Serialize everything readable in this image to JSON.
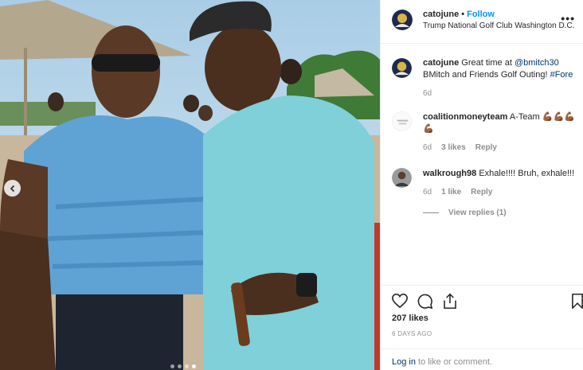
{
  "post": {
    "username": "catojune",
    "follow_label": "Follow",
    "location": "Trump National Golf Club Washington D.C.",
    "more_glyph": "•••"
  },
  "comments": [
    {
      "username": "catojune",
      "text_prefix": "Great time at ",
      "mention": "@bmitch30",
      "text_line2": "BMitch and Friends Golf Outing! ",
      "hashtag": "#Fore",
      "time": "6d"
    },
    {
      "username": "coalitionmoneyteam",
      "text": "A-Team 💪🏾💪🏾💪🏾💪🏾",
      "time": "6d",
      "likes": "3 likes",
      "reply_label": "Reply"
    },
    {
      "username": "walkrough98",
      "text": "Exhale!!!! Bruh, exhale!!!",
      "time": "6d",
      "likes": "1 like",
      "reply_label": "Reply",
      "view_replies": "View replies (1)"
    }
  ],
  "footer": {
    "likes": "207 likes",
    "date": "6 DAYS AGO",
    "login_link": "Log in",
    "login_rest": " to like or comment."
  },
  "carousel": {
    "slides": 4,
    "active_index": 3
  },
  "colors": {
    "link": "#0095f6",
    "mention": "#00376b",
    "muted": "#8e8e8e"
  }
}
